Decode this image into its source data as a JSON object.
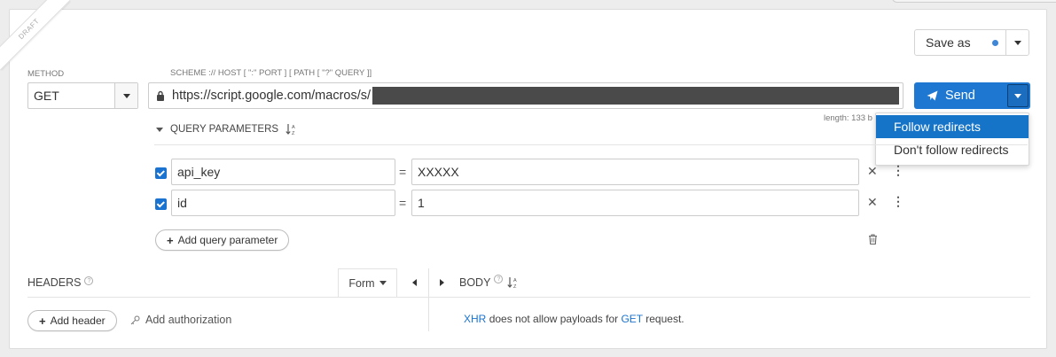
{
  "draft_ribbon": "DRAFT",
  "save_as": {
    "label": "Save as",
    "accent": "#3e86d6"
  },
  "method": {
    "label": "METHOD",
    "value": "GET"
  },
  "url": {
    "label": "SCHEME :// HOST [ \":\" PORT ] [ PATH [ \"?\" QUERY ]]",
    "value": "https://script.google.com/macros/s/",
    "length": "length: 133 b"
  },
  "send": {
    "label": "Send",
    "color": "#1e78d2"
  },
  "redirect_menu": {
    "items": [
      "Follow redirects",
      "Don't follow redirects"
    ],
    "active_index": 0
  },
  "query_parameters": {
    "title": "QUERY PARAMETERS",
    "equals": "=",
    "rows": [
      {
        "enabled": true,
        "name": "api_key",
        "value": "XXXXX"
      },
      {
        "enabled": true,
        "name": "id",
        "value": "1"
      }
    ],
    "add_label": "Add query parameter"
  },
  "headers": {
    "title": "HEADERS",
    "help": "?",
    "editor_mode": "Form",
    "add_header_label": "Add header",
    "add_auth_label": "Add authorization"
  },
  "body": {
    "title": "BODY",
    "help": "?",
    "message_link": "XHR",
    "message_mid": "does not allow payloads for",
    "message_method": "GET",
    "message_end": "request."
  }
}
